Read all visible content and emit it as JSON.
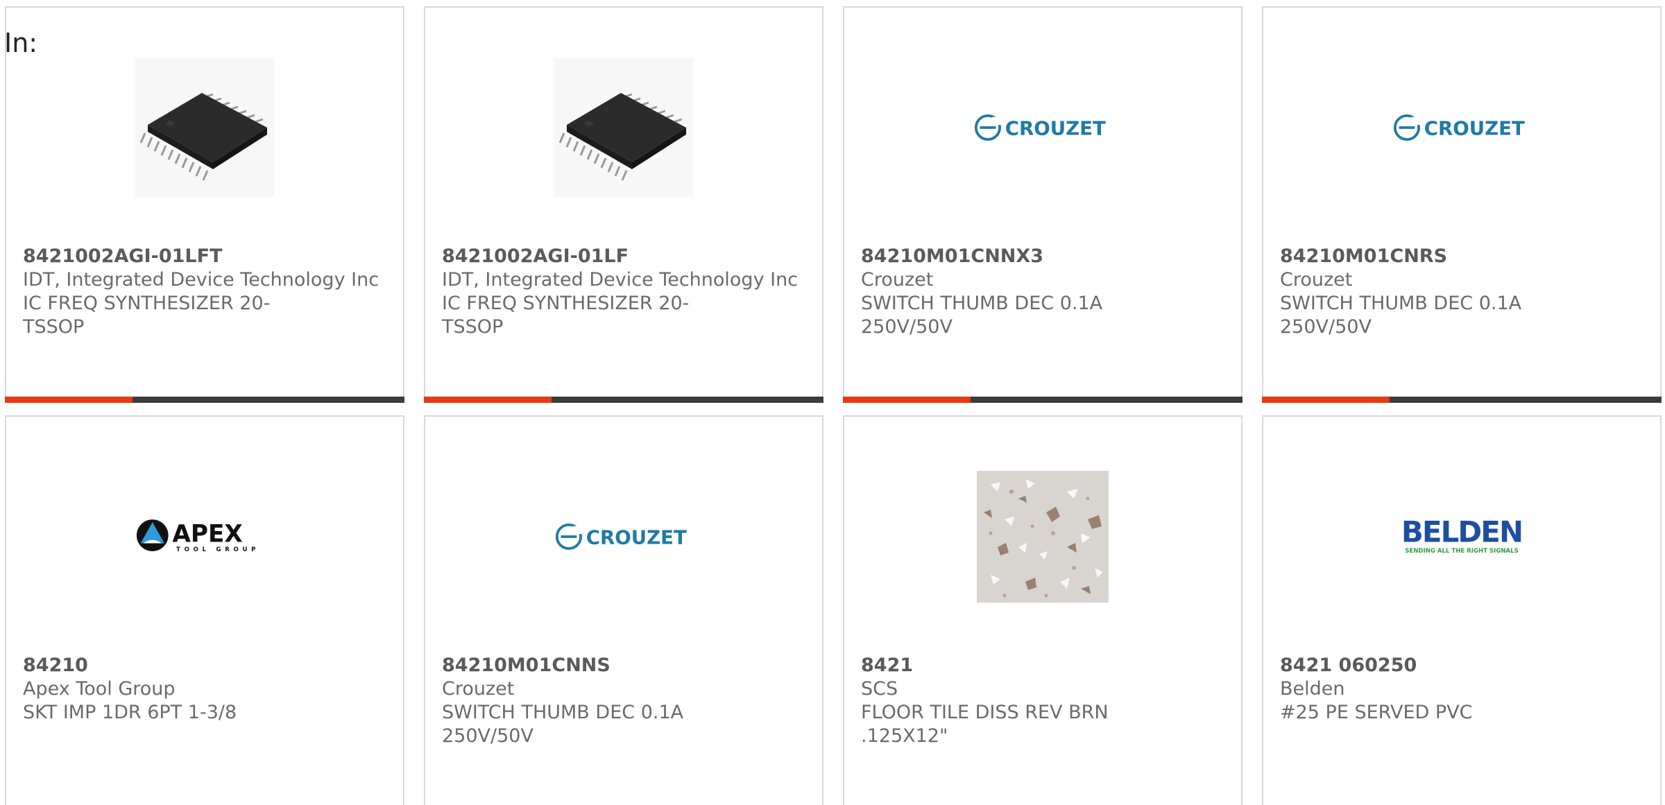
{
  "filter": {
    "label": "In:"
  },
  "brand_colors": {
    "accent_red": "#e63a12",
    "bar_dark": "#3c3c3c",
    "crouzet_blue": "#1f7aa6",
    "belden_blue": "#1d4fa0",
    "belden_green": "#2e9e3e"
  },
  "products": [
    {
      "part": "8421002AGI-01LFT",
      "maker": "IDT, Integrated Device Technology Inc",
      "desc": "IC FREQ SYNTHESIZER 20-TSSOP",
      "image": "tssop-chip-photo"
    },
    {
      "part": "8421002AGI-01LF",
      "maker": "IDT, Integrated Device Technology Inc",
      "desc": "IC FREQ SYNTHESIZER 20-TSSOP",
      "image": "tssop-chip-photo"
    },
    {
      "part": "84210M01CNNX3",
      "maker": "Crouzet",
      "desc": "SWITCH THUMB DEC 0.1A 250V/50V",
      "image": "crouzet-logo",
      "logo_text": "CROUZET"
    },
    {
      "part": "84210M01CNRS",
      "maker": "Crouzet",
      "desc": "SWITCH THUMB DEC 0.1A 250V/50V",
      "image": "crouzet-logo",
      "logo_text": "CROUZET"
    },
    {
      "part": "84210",
      "maker": "Apex Tool Group",
      "desc": "SKT IMP 1DR 6PT 1-3/8",
      "image": "apex-logo",
      "logo_text": "APEX",
      "logo_subtext": "TOOL GROUP"
    },
    {
      "part": "84210M01CNNS",
      "maker": "Crouzet",
      "desc": "SWITCH THUMB DEC 0.1A 250V/50V",
      "image": "crouzet-logo",
      "logo_text": "CROUZET"
    },
    {
      "part": "8421",
      "maker": "SCS",
      "desc": "FLOOR TILE DISS REV BRN .125X12\"",
      "image": "floor-tile-photo"
    },
    {
      "part": "8421 060250",
      "maker": "Belden",
      "desc": "#25 PE SERVED PVC",
      "image": "belden-logo",
      "logo_text": "BELDEN",
      "logo_subtext": "SENDING ALL THE RIGHT SIGNALS"
    }
  ]
}
